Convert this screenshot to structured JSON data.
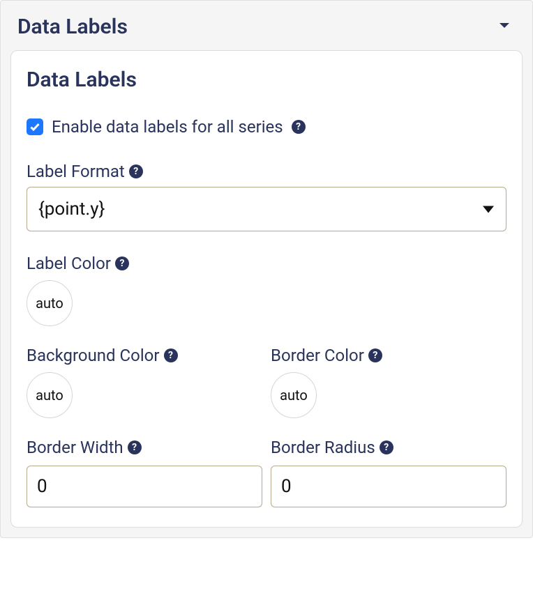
{
  "section": {
    "header_title": "Data Labels",
    "card_title": "Data Labels"
  },
  "enable": {
    "label": "Enable data labels for all series",
    "checked": true
  },
  "label_format": {
    "label": "Label Format",
    "value": "{point.y}"
  },
  "label_color": {
    "label": "Label Color",
    "value": "auto"
  },
  "background_color": {
    "label": "Background Color",
    "value": "auto"
  },
  "border_color": {
    "label": "Border Color",
    "value": "auto"
  },
  "border_width": {
    "label": "Border Width",
    "value": "0"
  },
  "border_radius": {
    "label": "Border Radius",
    "value": "0"
  },
  "help_glyph": "?"
}
